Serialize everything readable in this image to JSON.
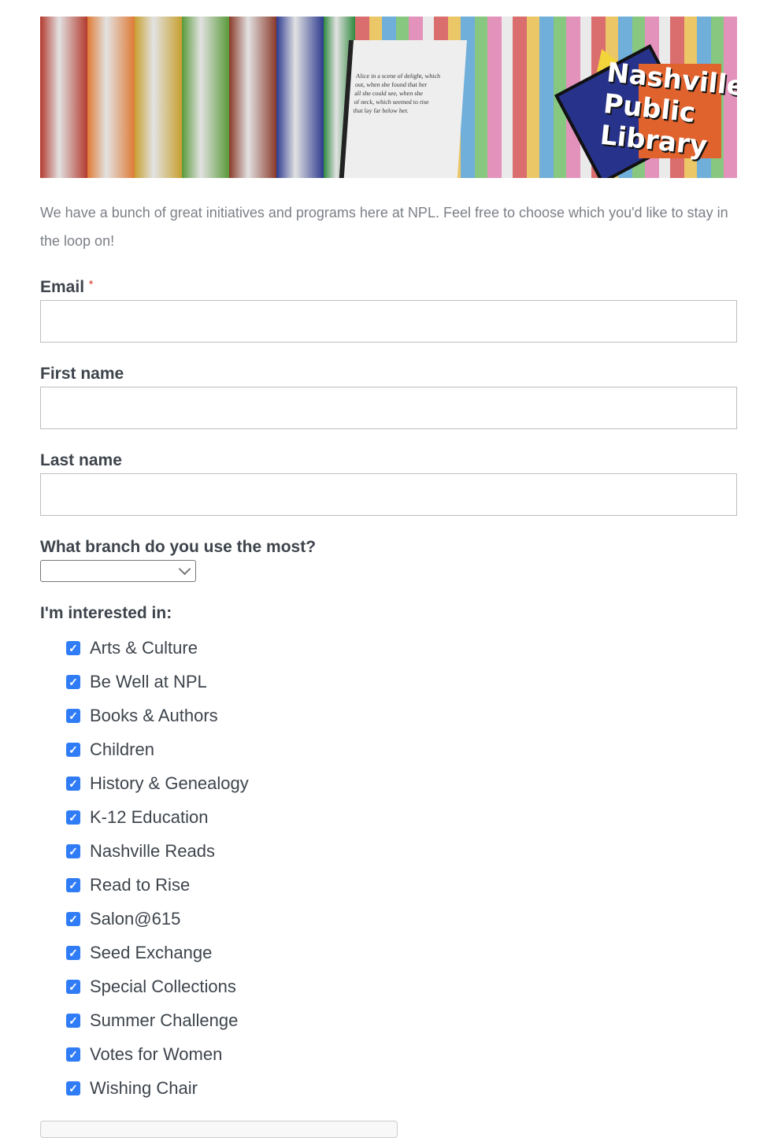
{
  "banner": {
    "logo_text": "Nashville Public Library",
    "book_colors": [
      "#b33a2e",
      "#e07a35",
      "#c8a030",
      "#5a9a3a",
      "#8a3a2a",
      "#2d3b8f",
      "#2f8a3f"
    ]
  },
  "intro": "We have a bunch of great initiatives and programs here at NPL. Feel free to choose which you'd like to stay in the loop on!",
  "fields": {
    "email": {
      "label": "Email",
      "required_mark": "*",
      "value": ""
    },
    "first_name": {
      "label": "First name",
      "value": ""
    },
    "last_name": {
      "label": "Last name",
      "value": ""
    },
    "branch": {
      "label": "What branch do you use the most?",
      "selected": ""
    }
  },
  "interests": {
    "label": "I'm interested in:",
    "items": [
      {
        "label": "Arts & Culture",
        "checked": true
      },
      {
        "label": "Be Well at NPL",
        "checked": true
      },
      {
        "label": "Books & Authors",
        "checked": true
      },
      {
        "label": "Children",
        "checked": true
      },
      {
        "label": "History & Genealogy",
        "checked": true
      },
      {
        "label": "K-12 Education",
        "checked": true
      },
      {
        "label": "Nashville Reads",
        "checked": true
      },
      {
        "label": "Read to Rise",
        "checked": true
      },
      {
        "label": "Salon@615",
        "checked": true
      },
      {
        "label": "Seed Exchange",
        "checked": true
      },
      {
        "label": "Special Collections",
        "checked": true
      },
      {
        "label": "Summer Challenge",
        "checked": true
      },
      {
        "label": "Votes for Women",
        "checked": true
      },
      {
        "label": "Wishing Chair",
        "checked": true
      }
    ]
  },
  "colors": {
    "accent": "#2f7cf6",
    "required": "#e05a4f"
  }
}
